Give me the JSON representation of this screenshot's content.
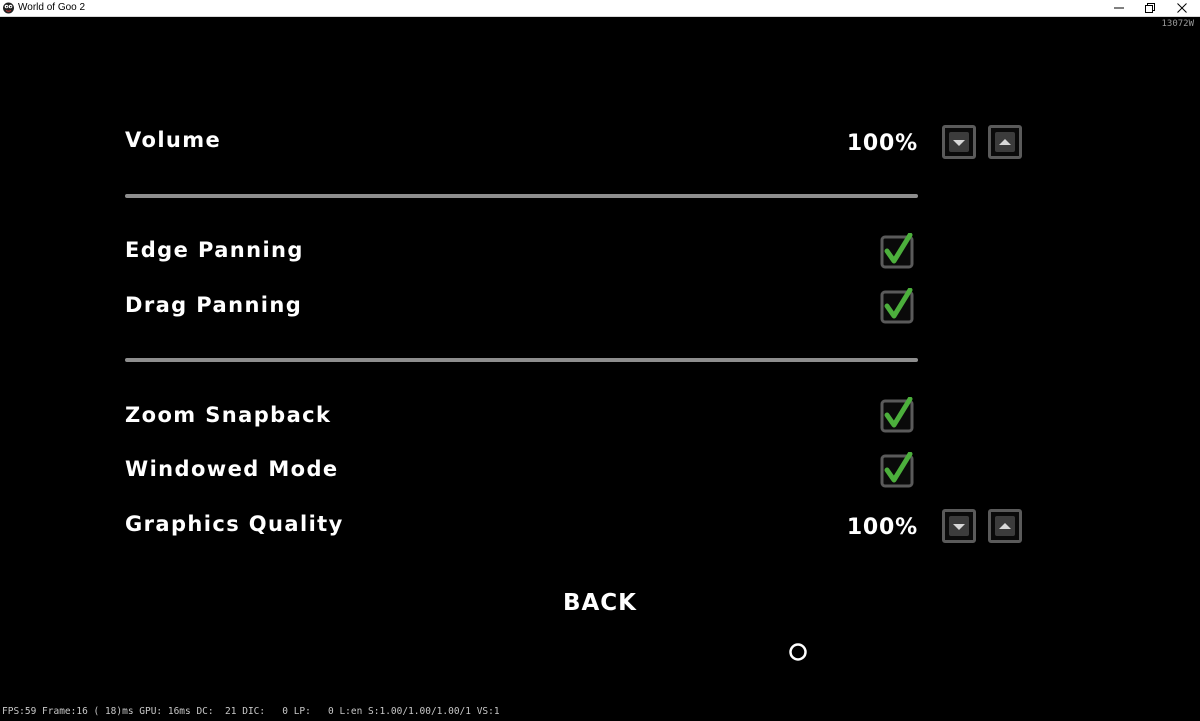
{
  "window": {
    "title": "World of Goo 2",
    "icon": "goo-ball-app-icon",
    "controls": [
      "minimize-icon",
      "restore-icon",
      "close-icon"
    ]
  },
  "build": "13072W",
  "options": {
    "volume": {
      "label": "Volume",
      "value": "100%"
    },
    "edge_panning": {
      "label": "Edge Panning",
      "checked": true
    },
    "drag_panning": {
      "label": "Drag Panning",
      "checked": true
    },
    "zoom_snapback": {
      "label": "Zoom Snapback",
      "checked": true
    },
    "windowed_mode": {
      "label": "Windowed Mode",
      "checked": true
    },
    "graphics_quality": {
      "label": "Graphics Quality",
      "value": "100%"
    }
  },
  "back_label": "BACK",
  "debug_line": "FPS:59 Frame:16 ( 18)ms GPU: 16ms DC:  21 DIC:   0 LP:   0 L:en S:1.00/1.00/1.00/1 VS:1",
  "colors": {
    "background": "#000000",
    "text": "#ffffff",
    "divider": "#8e8e8e",
    "checkmark": "#4caf3c",
    "button_border": "#5a5a5a"
  }
}
